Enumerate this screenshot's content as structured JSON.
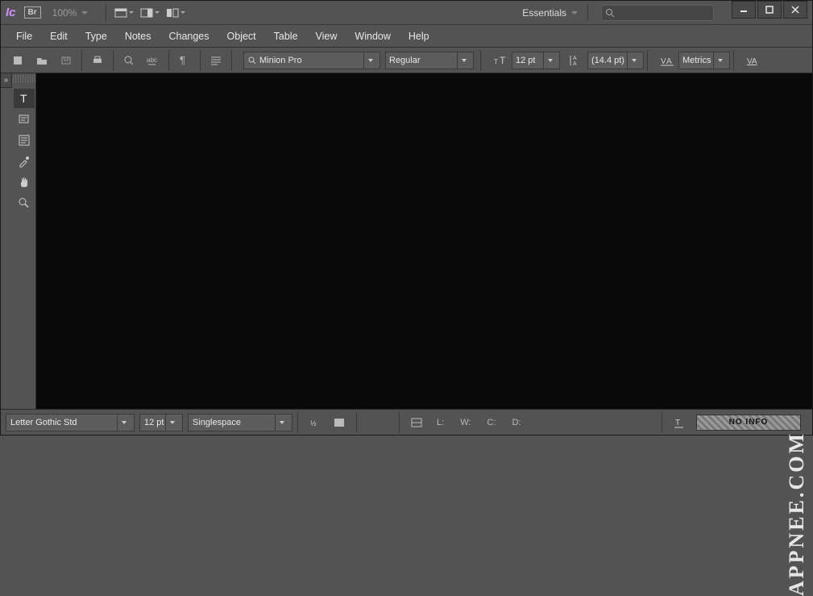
{
  "titlebar": {
    "app_label": "Ic",
    "bridge_badge": "Br",
    "zoom": "100%",
    "workspace": "Essentials",
    "search_placeholder": ""
  },
  "menu": {
    "items": [
      "File",
      "Edit",
      "Type",
      "Notes",
      "Changes",
      "Object",
      "Table",
      "View",
      "Window",
      "Help"
    ]
  },
  "toolbar": {
    "font_family": "Minion Pro",
    "font_style": "Regular",
    "font_size": "12 pt",
    "leading": "(14.4 pt)",
    "kerning": "Metrics"
  },
  "statusbar": {
    "font_family": "Letter Gothic Std",
    "font_size": "12 pt",
    "line_spacing": "Singlespace",
    "metric_L": "L:",
    "metric_W": "W:",
    "metric_C": "C:",
    "metric_D": "D:",
    "info_label": "NO INFO"
  },
  "watermark": "APPNEE.COM"
}
